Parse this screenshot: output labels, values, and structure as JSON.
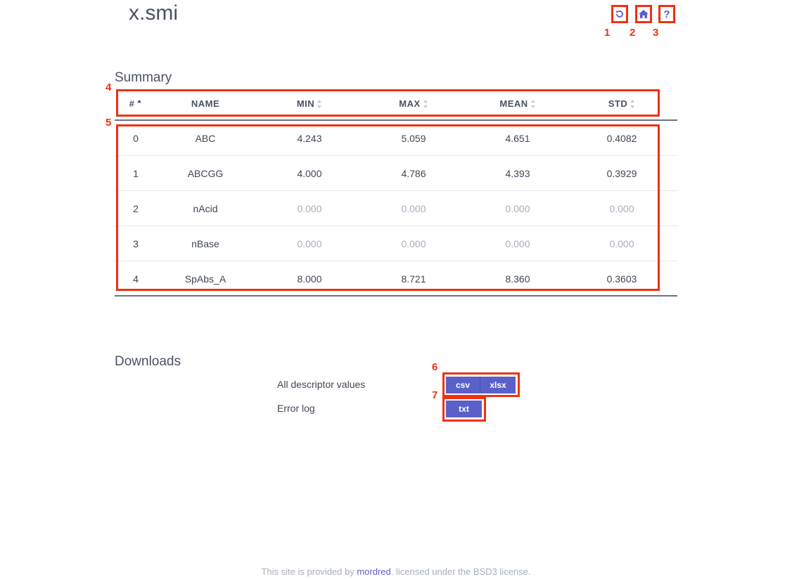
{
  "header": {
    "title": "x.smi",
    "icons": [
      "reload-icon",
      "home-icon",
      "help-icon"
    ],
    "help_glyph": "?"
  },
  "markers": [
    "1",
    "2",
    "3",
    "4",
    "5",
    "6",
    "7"
  ],
  "summary": {
    "title": "Summary",
    "columns": [
      "#",
      "NAME",
      "MIN",
      "MAX",
      "MEAN",
      "STD"
    ],
    "rows": [
      {
        "idx": "0",
        "name": "ABC",
        "min": "4.243",
        "max": "5.059",
        "mean": "4.651",
        "std": "0.4082"
      },
      {
        "idx": "1",
        "name": "ABCGG",
        "min": "4.000",
        "max": "4.786",
        "mean": "4.393",
        "std": "0.3929"
      },
      {
        "idx": "2",
        "name": "nAcid",
        "min": "0.000",
        "max": "0.000",
        "mean": "0.000",
        "std": "0.000"
      },
      {
        "idx": "3",
        "name": "nBase",
        "min": "0.000",
        "max": "0.000",
        "mean": "0.000",
        "std": "0.000"
      },
      {
        "idx": "4",
        "name": "SpAbs_A",
        "min": "8.000",
        "max": "8.721",
        "mean": "8.360",
        "std": "0.3603"
      }
    ]
  },
  "downloads": {
    "title": "Downloads",
    "descriptor_label": "All descriptor values",
    "csv_label": "csv",
    "xlsx_label": "xlsx",
    "error_label": "Error log",
    "txt_label": "txt"
  },
  "footer": {
    "prefix": "This site is provided by ",
    "link": "mordred",
    "suffix": ". licensed under the BSD3 license."
  },
  "colors": {
    "accent": "#5a60c9",
    "annotation": "#f1300f",
    "muted": "#a6adbb"
  }
}
